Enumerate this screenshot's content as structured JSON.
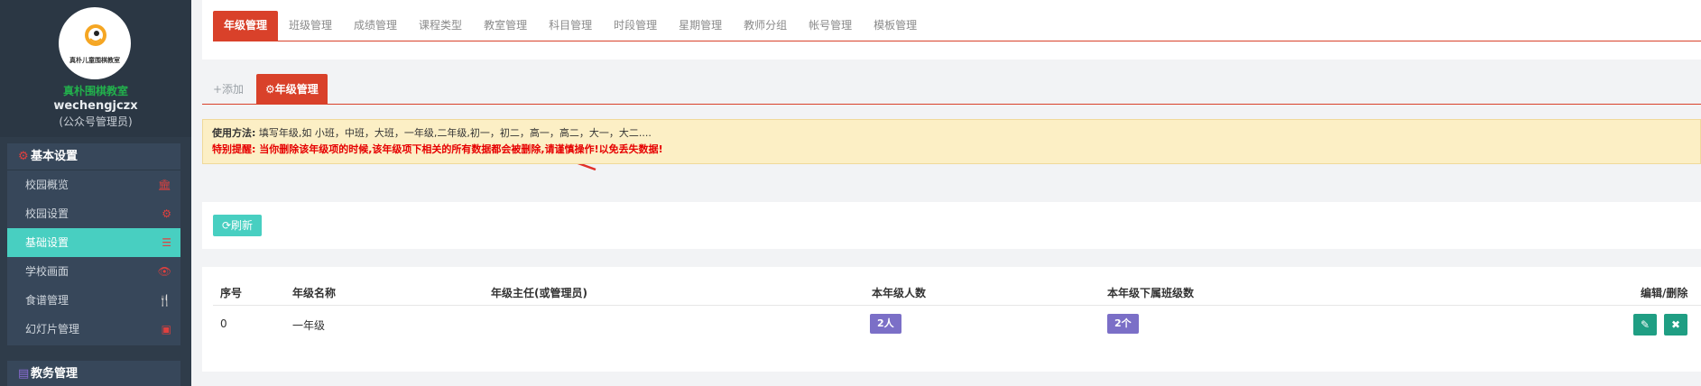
{
  "sidebar": {
    "avatar_text": "真朴儿童围棋教室",
    "school_name": "真朴围棋教室",
    "account": "wechengjczx",
    "role": "(公众号管理员)",
    "groups": [
      {
        "title": "基本设置",
        "items": [
          {
            "label": "校园概览",
            "icon": "bank-icon"
          },
          {
            "label": "校园设置",
            "icon": "gear-icon"
          },
          {
            "label": "基础设置",
            "icon": "list-icon",
            "active": true
          },
          {
            "label": "学校画面",
            "icon": "eye-icon"
          },
          {
            "label": "食谱管理",
            "icon": "utensils-icon"
          },
          {
            "label": "幻灯片管理",
            "icon": "image-icon"
          }
        ]
      },
      {
        "title": "教务管理"
      }
    ]
  },
  "top_tabs": [
    {
      "label": "年级管理",
      "active": true
    },
    {
      "label": "班级管理"
    },
    {
      "label": "成绩管理"
    },
    {
      "label": "课程类型"
    },
    {
      "label": "教室管理"
    },
    {
      "label": "科目管理"
    },
    {
      "label": "时段管理"
    },
    {
      "label": "星期管理"
    },
    {
      "label": "教师分组"
    },
    {
      "label": "帐号管理"
    },
    {
      "label": "模板管理"
    }
  ],
  "sub_tabs": {
    "add": "+添加",
    "active": "年级管理"
  },
  "notice": {
    "usage_label": "使用方法:",
    "usage_text": "填写年级,如 小班，中班，大班，一年级,二年级,初一，初二，高一，高二，大一，大二....",
    "warning": "特别提醒: 当你删除该年级项的时候,该年级项下相关的所有数据都会被删除,请谨慎操作!以免丢失数据!"
  },
  "refresh_label": "刷新",
  "table": {
    "headers": [
      "序号",
      "年级名称",
      "年级主任(或管理员)",
      "本年级人数",
      "本年级下属班级数",
      "编辑/删除"
    ],
    "rows": [
      {
        "index": "0",
        "name": "一年级",
        "director": "",
        "students": "2人",
        "classes": "2个"
      }
    ]
  },
  "colors": {
    "accent": "#d9412a",
    "teal": "#48cfc1",
    "badge": "#7b6fc7",
    "sidebar": "#2f3c4a",
    "edit": "#1f9e83"
  }
}
